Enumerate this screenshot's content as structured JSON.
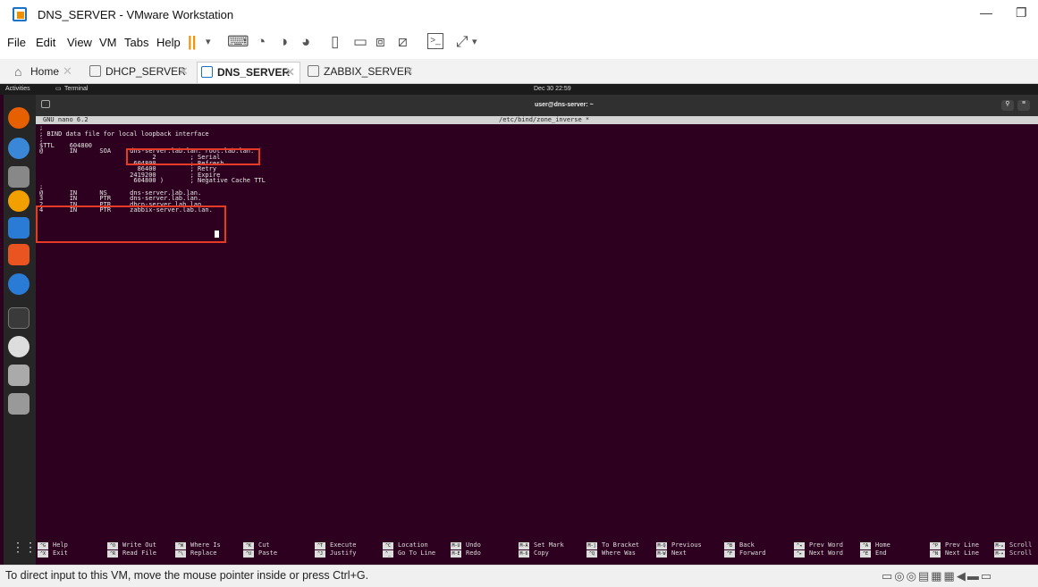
{
  "window": {
    "title": "DNS_SERVER - VMware Workstation",
    "minimize": "—",
    "restore": "❐"
  },
  "menu": [
    "File",
    "Edit",
    "View",
    "VM",
    "Tabs",
    "Help"
  ],
  "tabs": [
    {
      "label": "Home",
      "active": false
    },
    {
      "label": "DHCP_SERVER",
      "active": false
    },
    {
      "label": "DNS_SERVER",
      "active": true
    },
    {
      "label": "ZABBIX_SERVER",
      "active": false
    }
  ],
  "gnome": {
    "activities": "Activities",
    "app": "Terminal",
    "clock": "Dec 30 22:59"
  },
  "terminal": {
    "title": "user@dns-server: ~"
  },
  "nano": {
    "version": "GNU nano 6.2",
    "file": "/etc/bind/zone_inverse *"
  },
  "editor_lines": [
    ";",
    "; BIND data file for local loopback interface",
    ";",
    "$TTL    604800",
    "@       IN      SOA     dns-server.lab.lan. root.lab.lan. (",
    "                              2         ; Serial",
    "                         604800         ; Refresh",
    "                          86400         ; Retry",
    "                        2419200         ; Expire",
    "                         604800 )       ; Negative Cache TTL",
    ";",
    "@       IN      NS      dns-server.lab.lan.",
    "3       IN      PTR     dns-server.lab.lan.",
    "2       IN      PTR     dhcp-server.lab.lan.",
    "4       IN      PTR     zabbix-server.lab.lan."
  ],
  "shortcuts": [
    {
      "k1": "^G",
      "l1": "Help",
      "k2": "^X",
      "l2": "Exit"
    },
    {
      "k1": "^O",
      "l1": "Write Out",
      "k2": "^R",
      "l2": "Read File"
    },
    {
      "k1": "^W",
      "l1": "Where Is",
      "k2": "^\\",
      "l2": "Replace"
    },
    {
      "k1": "^K",
      "l1": "Cut",
      "k2": "^U",
      "l2": "Paste"
    },
    {
      "k1": "^T",
      "l1": "Execute",
      "k2": "^J",
      "l2": "Justify"
    },
    {
      "k1": "^C",
      "l1": "Location",
      "k2": "^_",
      "l2": "Go To Line"
    },
    {
      "k1": "M-U",
      "l1": "Undo",
      "k2": "M-E",
      "l2": "Redo"
    },
    {
      "k1": "M-A",
      "l1": "Set Mark",
      "k2": "M-6",
      "l2": "Copy"
    },
    {
      "k1": "M-]",
      "l1": "To Bracket",
      "k2": "^Q",
      "l2": "Where Was"
    },
    {
      "k1": "M-Q",
      "l1": "Previous",
      "k2": "M-W",
      "l2": "Next"
    },
    {
      "k1": "^B",
      "l1": "Back",
      "k2": "^F",
      "l2": "Forward"
    },
    {
      "k1": "^◂",
      "l1": "Prev Word",
      "k2": "^▸",
      "l2": "Next Word"
    },
    {
      "k1": "^A",
      "l1": "Home",
      "k2": "^E",
      "l2": "End"
    },
    {
      "k1": "^P",
      "l1": "Prev Line",
      "k2": "^N",
      "l2": "Next Line"
    },
    {
      "k1": "M-▴",
      "l1": "Scroll",
      "k2": "M-▾",
      "l2": "Scroll"
    }
  ],
  "status": {
    "message": "To direct input to this VM, move the mouse pointer inside or press Ctrl+G."
  },
  "colors": {
    "vm_bg": "#2c001e",
    "highlight": "#e53a26",
    "accent": "#f29100"
  }
}
